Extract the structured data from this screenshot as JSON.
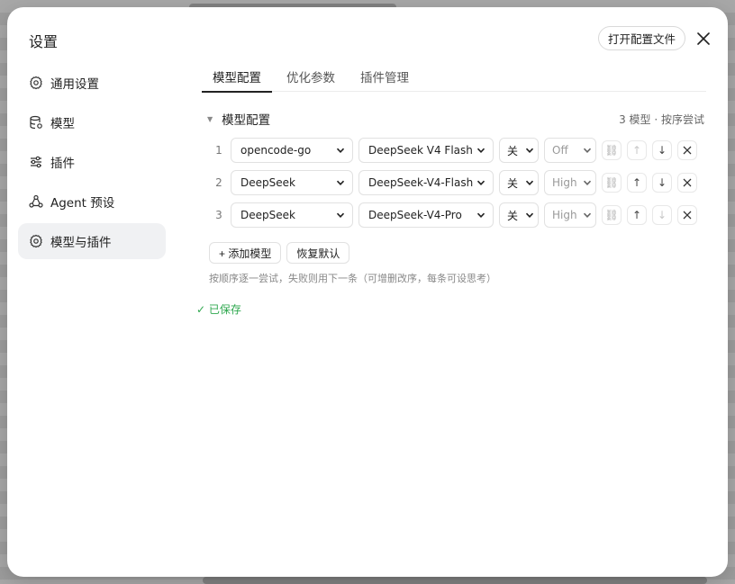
{
  "modal": {
    "title": "设置",
    "open_config_label": "打开配置文件"
  },
  "sidebar": {
    "items": [
      {
        "label": "通用设置",
        "icon": "gear-icon"
      },
      {
        "label": "模型",
        "icon": "database-icon"
      },
      {
        "label": "插件",
        "icon": "sliders-icon"
      },
      {
        "label": "Agent 预设",
        "icon": "agent-icon"
      },
      {
        "label": "模型与插件",
        "icon": "gear-icon",
        "active": true
      }
    ]
  },
  "tabs": [
    {
      "label": "模型配置",
      "active": true
    },
    {
      "label": "优化参数"
    },
    {
      "label": "插件管理"
    }
  ],
  "section": {
    "title": "模型配置",
    "meta": "3 模型 · 按序尝试"
  },
  "rows": [
    {
      "num": "1",
      "provider": "opencode-go",
      "model": "DeepSeek V4 Flash",
      "thinking": "关",
      "effort": "Off",
      "up_disabled": false,
      "down_disabled": false
    },
    {
      "num": "2",
      "provider": "DeepSeek",
      "model": "DeepSeek-V4-Flash",
      "thinking": "关",
      "effort": "High",
      "up_disabled": false,
      "down_disabled": false
    },
    {
      "num": "3",
      "provider": "DeepSeek",
      "model": "DeepSeek-V4-Pro",
      "thinking": "关",
      "effort": "High",
      "up_disabled": false,
      "down_disabled": true
    }
  ],
  "actions": {
    "add_model": "+ 添加模型",
    "reset_default": "恢复默认"
  },
  "hint": "按顺序逐一尝试，失败则用下一条（可增删改序，每条可设思考）",
  "saved_text": "✓ 已保存",
  "colors": {
    "accent_saved": "#2fa84f",
    "active_bg": "#f0f1f3"
  }
}
